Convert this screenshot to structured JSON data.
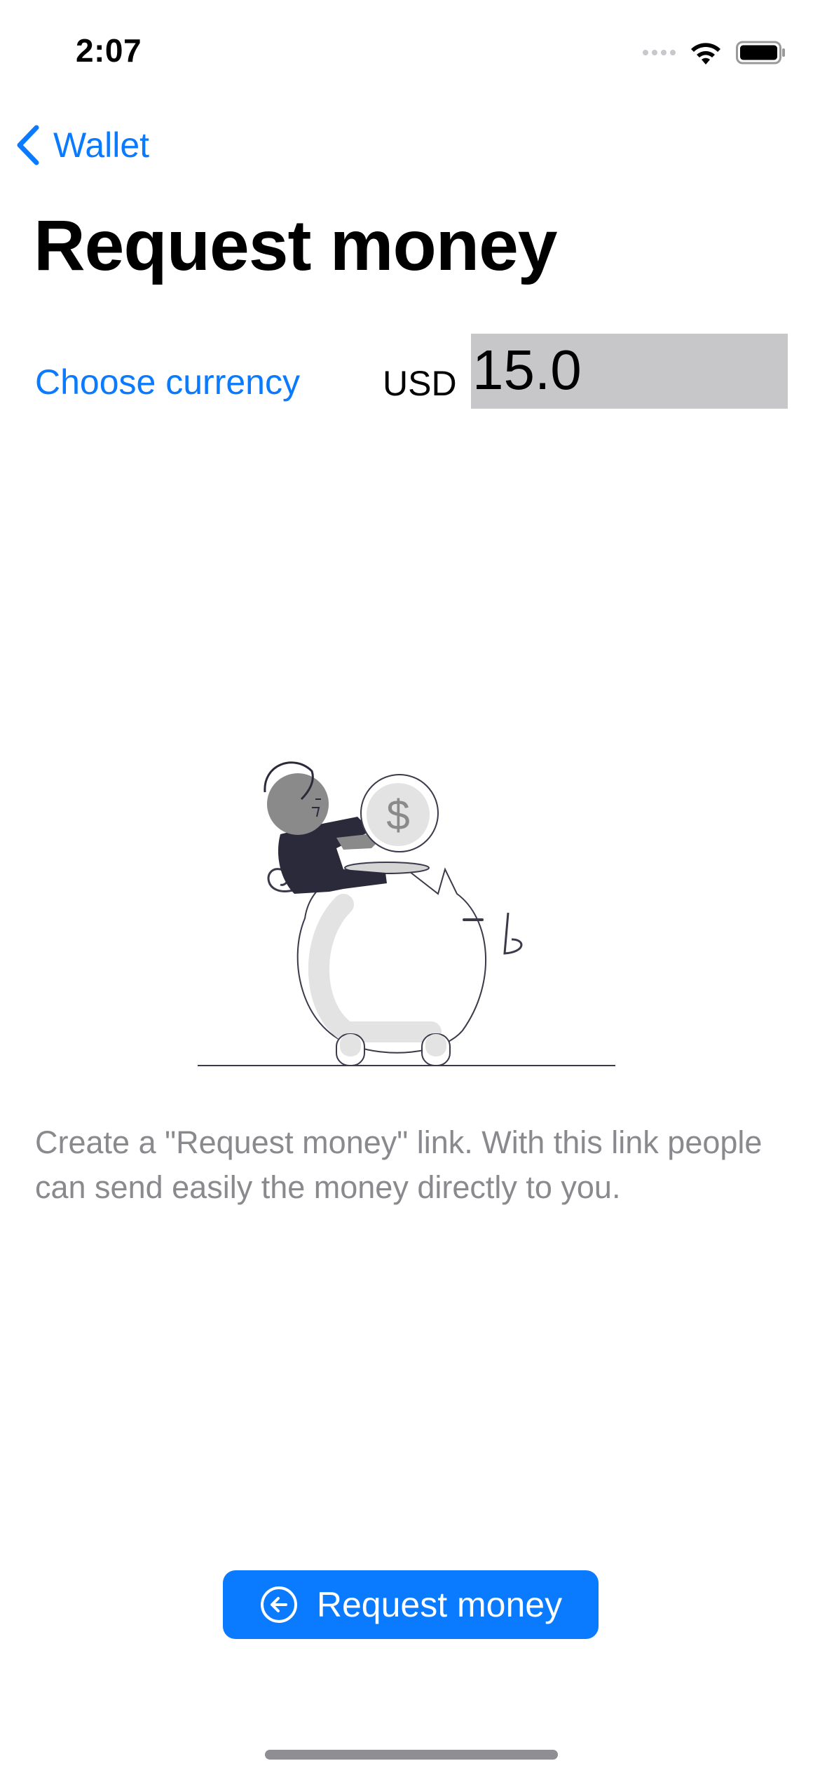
{
  "status_bar": {
    "time": "2:07"
  },
  "nav": {
    "back_label": "Wallet"
  },
  "page": {
    "title": "Request money"
  },
  "currency_row": {
    "choose_label": "Choose currency",
    "currency_code": "USD",
    "amount_value": "15.0"
  },
  "description": "Create a \"Request money\" link. With this link people can send easily the money directly to you.",
  "primary_action": {
    "label": "Request money",
    "icon": "arrow-left-circle-icon"
  },
  "colors": {
    "accent": "#0a7aff",
    "secondary_text": "#8a8a8e",
    "amount_field_bg": "#c7c7c9"
  }
}
